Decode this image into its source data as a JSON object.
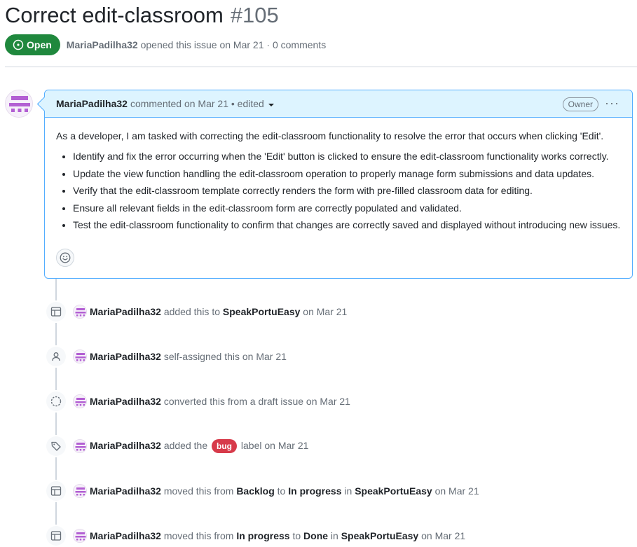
{
  "issue": {
    "title": "Correct edit-classroom",
    "number": "#105",
    "state": "Open",
    "author": "MariaPadilha32",
    "opened_text": "opened this issue on Mar 21 · 0 comments"
  },
  "comment": {
    "author": "MariaPadilha32",
    "meta": "commented on Mar 21 • edited",
    "badge": "Owner",
    "menu": "···",
    "intro": "As a developer, I am tasked with correcting the edit-classroom functionality to resolve the error that occurs when clicking 'Edit'.",
    "items": [
      "Identify and fix the error occurring when the 'Edit' button is clicked to ensure the edit-classroom functionality works correctly.",
      "Update the view function handling the edit-classroom operation to properly manage form submissions and data updates.",
      "Verify that the edit-classroom template correctly renders the form with pre-filled classroom data for editing.",
      "Ensure all relevant fields in the edit-classroom form are correctly populated and validated.",
      "Test the edit-classroom functionality to confirm that changes are correctly saved and displayed without introducing new issues."
    ]
  },
  "timeline": [
    {
      "icon": "table-icon",
      "user": "MariaPadilha32",
      "t1": "added this to",
      "b1": "SpeakPortuEasy",
      "t2": "on Mar 21"
    },
    {
      "icon": "person-icon",
      "user": "MariaPadilha32",
      "t1": "self-assigned this on Mar 21"
    },
    {
      "icon": "draft-circle-icon",
      "user": "MariaPadilha32",
      "t1": "converted this from a draft issue on Mar 21"
    },
    {
      "icon": "tag-icon",
      "user": "MariaPadilha32",
      "t1": "added the",
      "label": "bug",
      "t2": "label on Mar 21"
    },
    {
      "icon": "table-icon",
      "user": "MariaPadilha32",
      "t1": "moved this from",
      "b1": "Backlog",
      "t2": "to",
      "b2": "In progress",
      "t3": "in",
      "b3": "SpeakPortuEasy",
      "t4": "on Mar 21"
    },
    {
      "icon": "table-icon",
      "user": "MariaPadilha32",
      "t1": "moved this from",
      "b1": "In progress",
      "t2": "to",
      "b2": "Done",
      "t3": "in",
      "b3": "SpeakPortuEasy",
      "t4": "on Mar 21"
    }
  ],
  "colors": {
    "open_green": "#1f883d",
    "header_blue": "#ddf4ff",
    "border_blue": "#54aeff",
    "bug_red": "#d73a4a",
    "avatar_purple": "#b35fd3"
  }
}
